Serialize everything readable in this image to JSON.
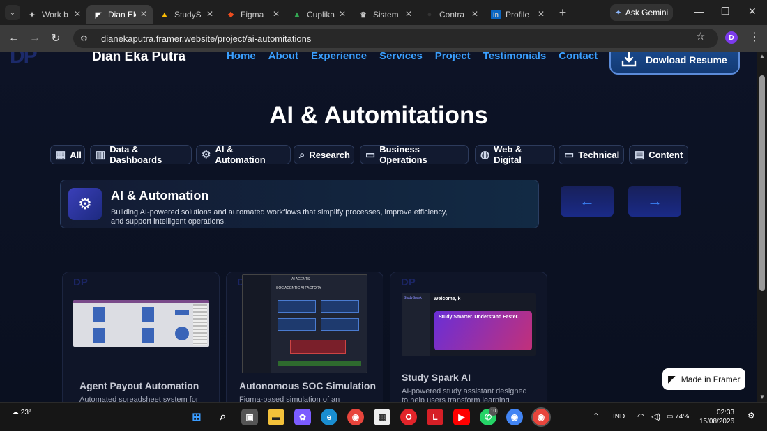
{
  "browser": {
    "tabs": [
      {
        "label": "Work b",
        "icon": "figma-like-icon"
      },
      {
        "label": "Dian Ek",
        "icon": "framer-icon",
        "active": true
      },
      {
        "label": "StudySp",
        "icon": "drive-icon"
      },
      {
        "label": "Figma",
        "icon": "figma-icon"
      },
      {
        "label": "Cuplika",
        "icon": "drive-icon"
      },
      {
        "label": "Sistem",
        "icon": "crown-icon"
      },
      {
        "label": "Contra",
        "icon": "contra-icon"
      },
      {
        "label": "Profile",
        "icon": "linkedin-icon"
      }
    ],
    "gemini_label": "Ask Gemini",
    "url": "dianekaputra.framer.website/project/ai-automitations",
    "profile_initial": "D"
  },
  "site": {
    "logo": "DP",
    "brand": "Dian Eka Putra",
    "nav": [
      "Home",
      "About",
      "Experience",
      "Services",
      "Project",
      "Testimonials",
      "Contact"
    ],
    "resume_button": "Dowload Resume",
    "page_title": "AI & Automitations",
    "filters": [
      "All",
      "Data & Dashboards",
      "AI & Automation",
      "Research",
      "Business Operations",
      "Web & Digital",
      "Technical",
      "Content"
    ],
    "featured": {
      "title": "AI & Automation",
      "description": "Building AI-powered solutions and automated workflows that simplify processes, improve efficiency, and support intelligent operations."
    },
    "cards": [
      {
        "title": "Agent Payout Automation",
        "description": "Automated spreadsheet system for"
      },
      {
        "title": "Autonomous SOC Simulation",
        "description": "Figma-based simulation of an"
      },
      {
        "title": "Study Spark AI",
        "description": "AI-powered study assistant designed to help users transform learning"
      }
    ],
    "card_screens": {
      "soc_header": "AI AGENTS",
      "soc_title": "SOC AGENTIC AI FACTORY",
      "study_brand": "StudySpark",
      "study_welcome": "Welcome, k",
      "study_hero": "Study Smarter. Understand Faster."
    },
    "framer_badge": "Made in Framer"
  },
  "taskbar": {
    "temperature": "23°",
    "notification_count": "10",
    "language": "IND",
    "battery": "74%",
    "time": "02:33",
    "date": "15/08/2026"
  },
  "colors": {
    "accent_blue": "#3aa0ff",
    "page_bg": "#0b1020",
    "arrow_blue": "#3b82f6"
  }
}
